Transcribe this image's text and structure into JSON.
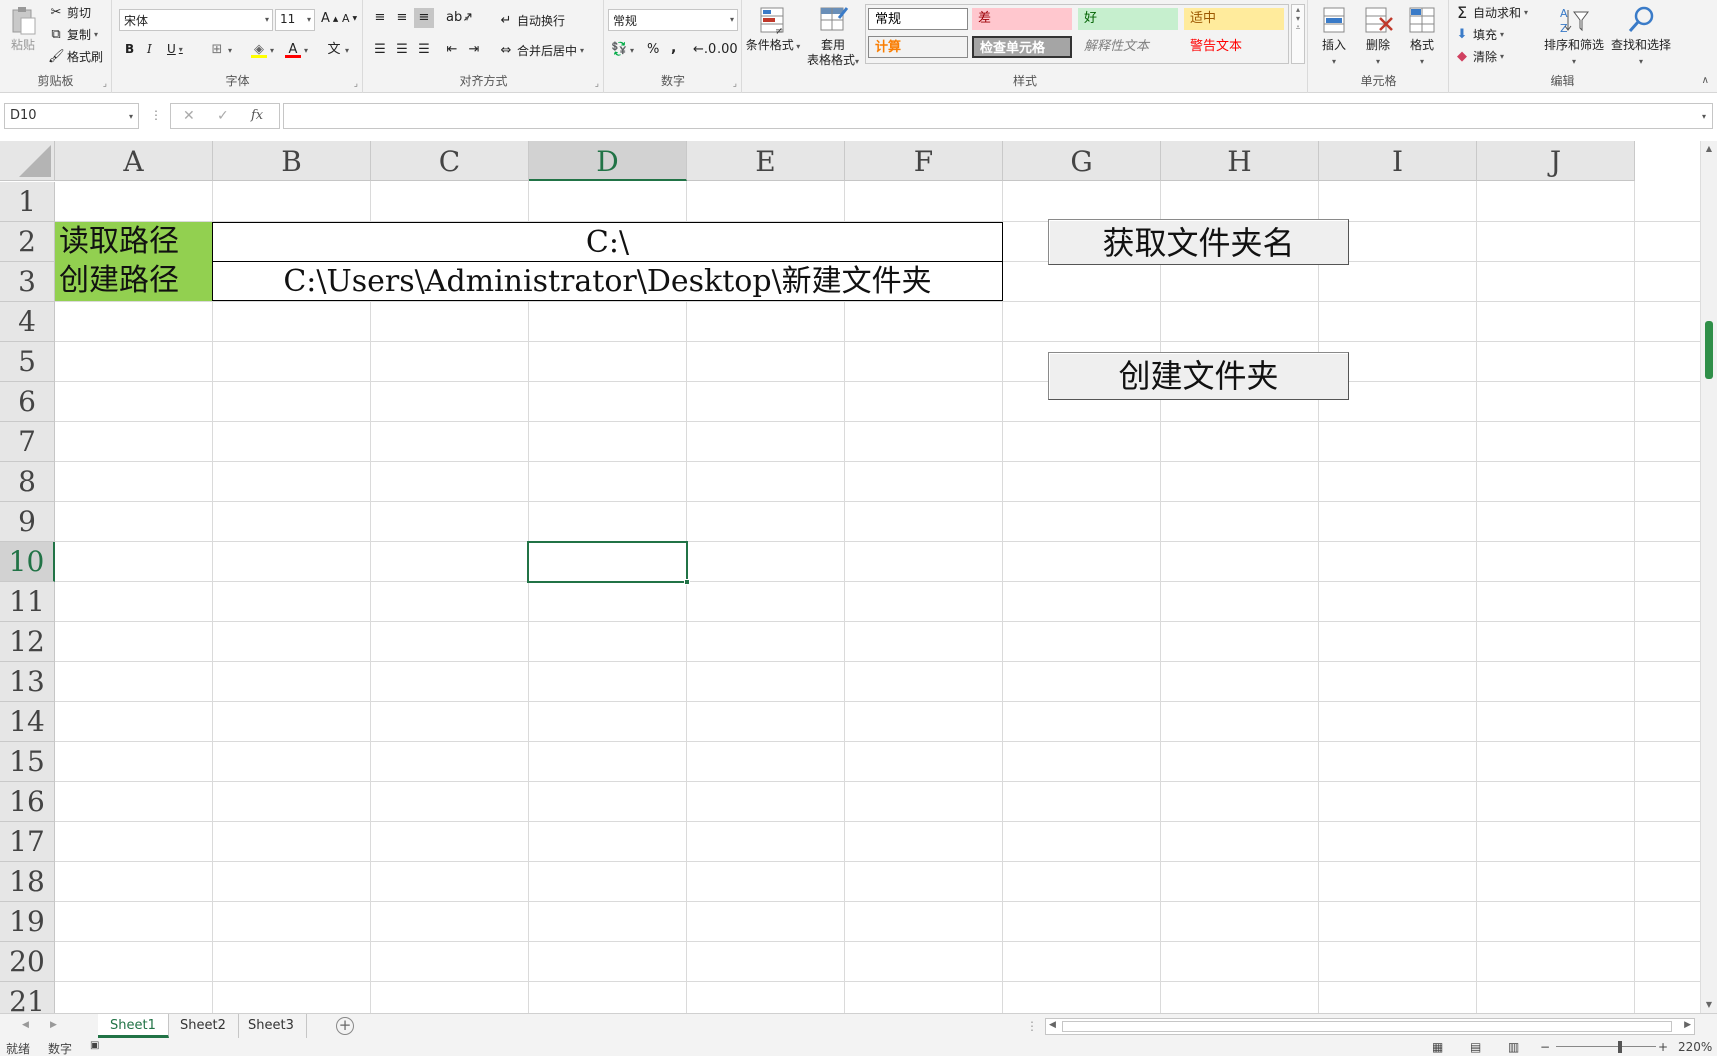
{
  "ribbon": {
    "clipboard": {
      "paste": "粘贴",
      "cut": "剪切",
      "copy": "复制",
      "format_painter": "格式刷",
      "label": "剪贴板"
    },
    "font": {
      "name": "宋体",
      "size": "11",
      "bold": "B",
      "italic": "I",
      "underline": "U",
      "grow": "A",
      "shrink": "A",
      "label": "字体"
    },
    "alignment": {
      "wrap": "自动换行",
      "merge": "合并后居中",
      "label": "对齐方式"
    },
    "number": {
      "format": "常规",
      "percent": "%",
      "comma": ",",
      "label": "数字"
    },
    "styles": {
      "conditional": "条件格式",
      "table_format_1": "套用",
      "table_format_2": "表格格式",
      "cells": [
        {
          "text": "常规",
          "bg": "#ffffff",
          "fg": "#000000"
        },
        {
          "text": "差",
          "bg": "#ffc7ce",
          "fg": "#9c0006"
        },
        {
          "text": "好",
          "bg": "#c6efce",
          "fg": "#006100"
        },
        {
          "text": "适中",
          "bg": "#ffeb9c",
          "fg": "#9c5700"
        },
        {
          "text": "计算",
          "bg": "#f2f2f2",
          "fg": "#fa7d00"
        },
        {
          "text": "检查单元格",
          "bg": "#a5a5a5",
          "fg": "#ffffff"
        },
        {
          "text": "解释性文本",
          "bg": "#f3f3f3",
          "fg": "#7f7f7f"
        },
        {
          "text": "警告文本",
          "bg": "#f3f3f3",
          "fg": "#ff0000"
        }
      ],
      "label": "样式"
    },
    "cells": {
      "insert": "插入",
      "delete": "删除",
      "format": "格式",
      "label": "单元格"
    },
    "editing": {
      "autosum": "自动求和",
      "fill": "填充",
      "clear": "清除",
      "sort": "排序和筛选",
      "find": "查找和选择",
      "label": "编辑"
    }
  },
  "formula_bar": {
    "name_box": "D10",
    "fx": "fx",
    "cancel": "✕",
    "enter": "✓",
    "value": ""
  },
  "columns": [
    "A",
    "B",
    "C",
    "D",
    "E",
    "F",
    "G",
    "H",
    "I",
    "J"
  ],
  "rows": [
    "1",
    "2",
    "3",
    "4",
    "5",
    "6",
    "7",
    "8",
    "9",
    "10",
    "11",
    "12",
    "13",
    "14",
    "15",
    "16",
    "17",
    "18",
    "19",
    "20",
    "21"
  ],
  "cells": {
    "A2": "读取路径",
    "A3": "创建路径",
    "B2": "C:\\",
    "B3": "C:\\Users\\Administrator\\Desktop\\新建文件夹"
  },
  "buttons": {
    "get_folder_names": "获取文件夹名",
    "create_folder": "创建文件夹"
  },
  "sheets": [
    "Sheet1",
    "Sheet2",
    "Sheet3"
  ],
  "status": {
    "ready": "就绪",
    "mode": "数字",
    "zoom": "220%"
  },
  "colors": {
    "accent": "#217346",
    "label_fill": "#92d050"
  }
}
